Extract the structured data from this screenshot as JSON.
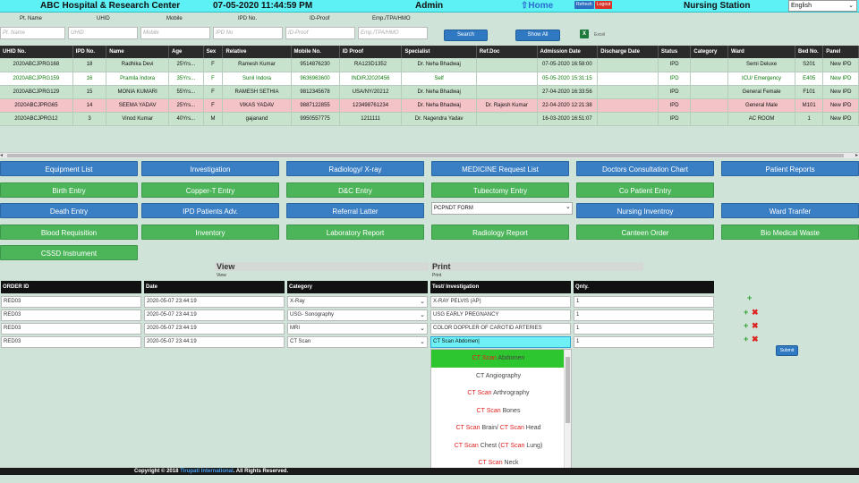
{
  "topbar": {
    "hospital": "ABC Hospital & Research Center",
    "datetime": "07-05-2020 11:44:59 PM",
    "user": "Admin",
    "home": "⇧Home",
    "refresh": "Refresh",
    "logout": "Logout",
    "station": "Nursing Station",
    "language": "English"
  },
  "filters": {
    "labels": [
      "Pt. Name",
      "UHID",
      "Mobile",
      "IPD No.",
      "ID-Proof",
      "Emp./TPA/HMO"
    ],
    "placeholders": [
      "Pt. Name",
      "UHID",
      "Mobile",
      "IPD No",
      "ID-Proof",
      "Emp./TPA/HMO"
    ],
    "search": "Search",
    "show_all": "Show All",
    "excel": "Excel"
  },
  "patients": {
    "columns": [
      "UHID No.",
      "IPD No.",
      "Name",
      "Age",
      "Sex",
      "Relative",
      "Mobile No.",
      "ID Proof",
      "Specialist",
      "Ref.Doc",
      "Admission Date",
      "Discharge Date",
      "Status",
      "Category",
      "Ward",
      "Bed No.",
      "Panel"
    ],
    "rows": [
      {
        "style": "green",
        "cells": [
          "2020ABCJPRG168",
          "18",
          "Radhika Devi",
          "25Yrs...",
          "F",
          "Ramesh Kumar",
          "9514876230",
          "RA123D1352",
          "Dr. Neha Bhadwaj",
          "",
          "07-05-2020 16:58:00",
          "",
          "IPD",
          "",
          "Semi Deluxe",
          "S201",
          "New IPD"
        ]
      },
      {
        "style": "white",
        "cells": [
          "2020ABCJPRG159",
          "16",
          "Pramila Indora",
          "35Yrs...",
          "F",
          "Sunil Indora",
          "9636963600",
          "INDIRJ2020456",
          "Self",
          "",
          "05-05-2020 15:31:15",
          "",
          "IPD",
          "",
          "ICU/ Emergency",
          "E405",
          "New IPD"
        ]
      },
      {
        "style": "green",
        "cells": [
          "2020ABCJPRG129",
          "15",
          "MONIA KUMARI",
          "55Yrs...",
          "F",
          "RAMESH SETHIA",
          "9812345678",
          "USA/NY/20212",
          "Dr. Neha Bhadwaj",
          "",
          "27-04-2020 16:33:56",
          "",
          "IPD",
          "",
          "General Female",
          "F101",
          "New IPD"
        ]
      },
      {
        "style": "pink",
        "cells": [
          "2020ABCJPRG65",
          "14",
          "SEEMA YADAV",
          "25Yrs...",
          "F",
          "VIKAS YADAV",
          "9887122855",
          "123498761234",
          "Dr. Neha Bhadwaj",
          "Dr. Rajesh Kumar",
          "22-04-2020 12:21:38",
          "",
          "IPD",
          "",
          "General Male",
          "M101",
          "New IPD"
        ]
      },
      {
        "style": "green",
        "cells": [
          "2020ABCJPRG12",
          "3",
          "Vinod Kumar",
          "40Yrs...",
          "M",
          "gajanand",
          "9950557775",
          "1211111",
          "Dr. Nagendra Yadav",
          "",
          "16-03-2020 16:51:07",
          "",
          "IPD",
          "",
          "AC ROOM",
          "1",
          "New IPD"
        ]
      }
    ]
  },
  "actions": {
    "row1": [
      "Equipment List",
      "Investigation",
      "Radiology/ X-ray",
      "MEDICINE Request List",
      "Doctors Consultation Chart",
      "Patient Reports"
    ],
    "row2": [
      "Birth Entry",
      "Copper-T Entry",
      "D&C Entry",
      "Tubectomy Entry",
      "Co Patient Entry"
    ],
    "row3": [
      "Death Entry",
      "IPD Patients Adv.",
      "Referral Latter",
      "PCPNDT FORM",
      "Nursing Inventroy",
      "Ward Tranfer"
    ],
    "row4": [
      "Blood Requisition",
      "Inventory",
      "Laboratory Report",
      "Radiology Report",
      "Canteen Order",
      "Bio Medical Waste"
    ],
    "row5": [
      "CSSD Instrument"
    ]
  },
  "sections": {
    "view": "View",
    "view_sub": "View",
    "print": "Print",
    "print_sub": "Print"
  },
  "orders": {
    "columns": [
      "ORDER ID",
      "Date",
      "Category",
      "Test/ Investigation",
      "Qnty."
    ],
    "rows": [
      [
        "RED03",
        "2020-05-07 23:44:19",
        "X-Ray",
        "X-RAY PELVIS (AP)",
        "1"
      ],
      [
        "RED03",
        "2020-05-07 23:44:19",
        "USG- Sonography",
        "USG EARLY PREGNANCY",
        "1"
      ],
      [
        "RED03",
        "2020-05-07 23:44:19",
        "MRI",
        "COLOR DOPPLER OF CAROTID ARTERIES",
        "1"
      ],
      [
        "RED03",
        "2020-05-07 23:44:19",
        "CT Scan",
        "CT Scan Abdomen",
        "1"
      ]
    ],
    "submit": "Submit"
  },
  "dropdown": {
    "items": [
      {
        "hl1": "CT Scan",
        "rest1": " Abdomen",
        "hl2": "",
        "rest2": ""
      },
      {
        "hl1": "",
        "rest1": "CT Angiography",
        "hl2": "",
        "rest2": ""
      },
      {
        "hl1": "CT Scan",
        "rest1": " Arthrography",
        "hl2": "",
        "rest2": ""
      },
      {
        "hl1": "CT Scan",
        "rest1": " Bones",
        "hl2": "",
        "rest2": ""
      },
      {
        "hl1": "CT Scan",
        "rest1": " Brain/ ",
        "hl2": "CT Scan",
        "rest2": " Head"
      },
      {
        "hl1": "CT Scan",
        "rest1": " Chest (",
        "hl2": "CT Scan",
        "rest2": " Lung)"
      },
      {
        "hl1": "CT Scan",
        "rest1": " Neck",
        "hl2": "",
        "rest2": ""
      }
    ]
  },
  "footer": {
    "pre": "Copyright © 2018 ",
    "link": "Tirupati International",
    "post": ". All Rights Reserved."
  },
  "colors": {
    "topbar": "#5df0f4",
    "blue_button": "#3a7ec4",
    "green_button": "#4cb55a",
    "active_option": "#2ec62e"
  }
}
